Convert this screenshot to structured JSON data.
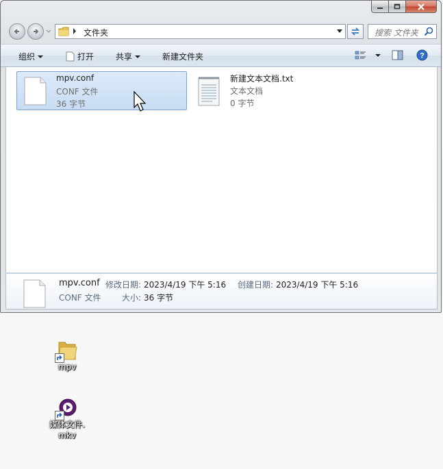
{
  "window": {
    "address": {
      "current": "文件夹"
    },
    "search": {
      "placeholder": "搜索 文件夹"
    }
  },
  "toolbar": {
    "organize": "组织",
    "open": "打开",
    "share": "共享",
    "new_folder": "新建文件夹"
  },
  "files": [
    {
      "name": "mpv.conf",
      "type": "CONF 文件",
      "size": "36 字节",
      "icon": "blank-file-icon",
      "selected": true
    },
    {
      "name": "新建文本文档.txt",
      "type": "文本文档",
      "size": "0 字节",
      "icon": "text-file-icon",
      "selected": false
    }
  ],
  "details": {
    "name": "mpv.conf",
    "type": "CONF 文件",
    "modified_label": "修改日期:",
    "modified_value": "2023/4/19 下午 5:16",
    "created_label": "创建日期:",
    "created_value": "2023/4/19 下午 5:16",
    "size_label": "大小:",
    "size_value": "36 字节"
  },
  "desktop": {
    "icons": [
      {
        "label": "mpv",
        "icon": "folder-shortcut-icon"
      },
      {
        "label1": "媒体文件.",
        "label2": "mkv",
        "icon": "media-player-shortcut-icon"
      }
    ]
  },
  "colors": {
    "selection": "#cfe1f5",
    "selection_border": "#7da2ce",
    "close_button": "#c7513a"
  }
}
